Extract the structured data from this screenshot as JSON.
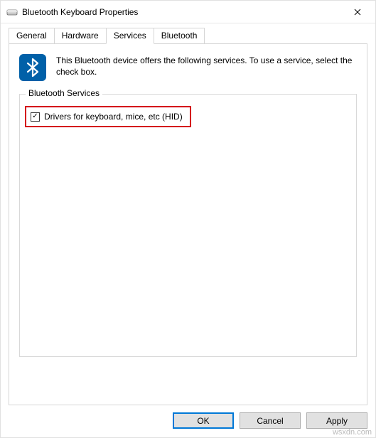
{
  "window": {
    "title": "Bluetooth Keyboard Properties"
  },
  "tabs": {
    "general": "General",
    "hardware": "Hardware",
    "services": "Services",
    "bluetooth": "Bluetooth"
  },
  "panel": {
    "info_text": "This Bluetooth device offers the following services. To use a service, select the check box.",
    "fieldset_legend": "Bluetooth Services",
    "service_hid_label": "Drivers for keyboard, mice, etc (HID)",
    "service_hid_checked": true
  },
  "buttons": {
    "ok": "OK",
    "cancel": "Cancel",
    "apply": "Apply"
  },
  "watermark": "wsxdn.com"
}
